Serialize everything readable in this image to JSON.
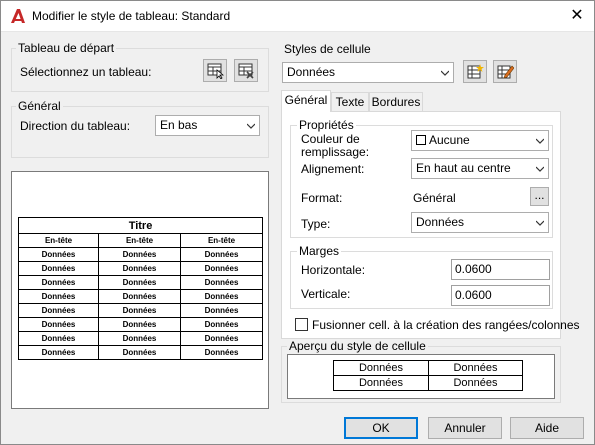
{
  "window": {
    "title": "Modifier le style de tableau: Standard"
  },
  "icons": {
    "app": "autocad-a-icon",
    "close": "close-icon"
  },
  "colors": {
    "accent": "#0078d7",
    "app_icon": "#c62828"
  },
  "left": {
    "start_table": {
      "title": "Tableau de départ",
      "select_label": "Sélectionnez un tableau:"
    },
    "general": {
      "title": "Général",
      "direction_label": "Direction du tableau:",
      "direction_value": "En bas"
    },
    "preview": {
      "title": "Titre",
      "headers": [
        "En-tête",
        "En-tête",
        "En-tête"
      ],
      "rows": [
        [
          "Données",
          "Données",
          "Données"
        ],
        [
          "Données",
          "Données",
          "Données"
        ],
        [
          "Données",
          "Données",
          "Données"
        ],
        [
          "Données",
          "Données",
          "Données"
        ],
        [
          "Données",
          "Données",
          "Données"
        ],
        [
          "Données",
          "Données",
          "Données"
        ],
        [
          "Données",
          "Données",
          "Données"
        ],
        [
          "Données",
          "Données",
          "Données"
        ]
      ]
    }
  },
  "right": {
    "cell_styles": {
      "title": "Styles de cellule",
      "value": "Données"
    },
    "tabs": [
      {
        "label": "Général",
        "active": true
      },
      {
        "label": "Texte",
        "active": false
      },
      {
        "label": "Bordures",
        "active": false
      }
    ],
    "properties": {
      "title": "Propriétés",
      "fill_label": "Couleur de remplissage:",
      "fill_value": "Aucune",
      "align_label": "Alignement:",
      "align_value": "En haut au centre",
      "format_label": "Format:",
      "format_value": "Général",
      "format_button": "...",
      "type_label": "Type:",
      "type_value": "Données"
    },
    "margins": {
      "title": "Marges",
      "horizontal_label": "Horizontale:",
      "horizontal_value": "0.0600",
      "vertical_label": "Verticale:",
      "vertical_value": "0.0600"
    },
    "merge_checkbox": {
      "label": "Fusionner cell. à la création des rangées/colonnes",
      "checked": false
    },
    "cell_preview": {
      "title": "Aperçu du style de cellule",
      "rows": [
        [
          "Données",
          "Données"
        ],
        [
          "Données",
          "Données"
        ]
      ]
    }
  },
  "buttons": {
    "ok": "OK",
    "cancel": "Annuler",
    "help": "Aide"
  }
}
